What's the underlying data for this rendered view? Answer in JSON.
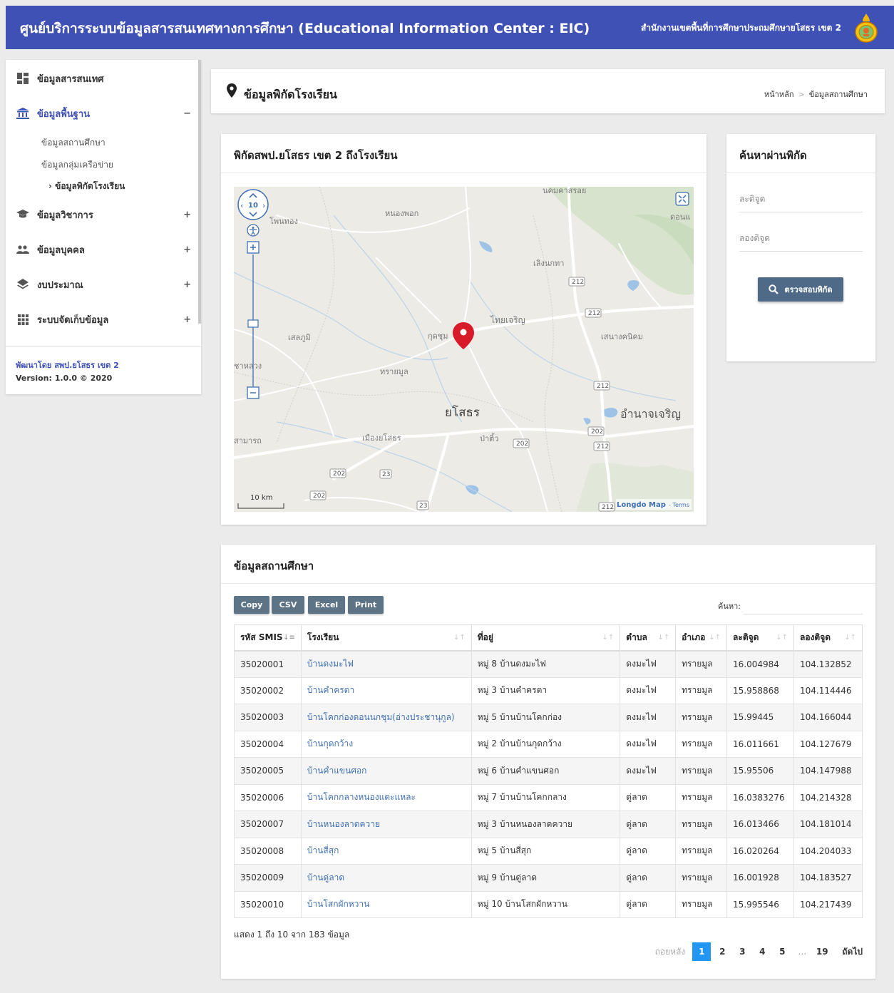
{
  "header": {
    "title": "ศูนย์บริการระบบข้อมูลสารสนเทศทางการศึกษา (Educational Information Center : EIC)",
    "office": "สำนักงานเขตพื้นที่การศึกษาประถมศึกษายโสธร เขต 2",
    "logo_icon": "school-emblem-icon"
  },
  "sidebar": {
    "items": [
      {
        "label": "ข้อมูลสารสนเทศ",
        "icon": "dashboard-icon",
        "toggle": ""
      },
      {
        "label": "ข้อมูลพื้นฐาน",
        "icon": "institution-icon",
        "toggle": "−"
      },
      {
        "label": "ข้อมูลวิชาการ",
        "icon": "graduation-cap-icon",
        "toggle": "+"
      },
      {
        "label": "ข้อมูลบุคคล",
        "icon": "people-icon",
        "toggle": "+"
      },
      {
        "label": "งบประมาณ",
        "icon": "layers-icon",
        "toggle": "+"
      },
      {
        "label": "ระบบจัดเก็บข้อมูล",
        "icon": "grid-icon",
        "toggle": "+"
      }
    ],
    "subitems": [
      "ข้อมูลสถานศึกษา",
      "ข้อมูลกลุ่มเครือข่าย",
      "ข้อมูลพิกัดโรงเรียน"
    ],
    "footer_dev": "พัฒนาโดย สพป.ยโสธร เขต 2",
    "footer_version": "Version: 1.0.0 © 2020"
  },
  "page": {
    "title": "ข้อมูลพิกัดโรงเรียน",
    "breadcrumb": [
      "หน้าหลัก",
      ">",
      "ข้อมูลสถานศึกษา"
    ]
  },
  "map": {
    "title": "พิกัดสพป.ยโสธร เขต 2 ถึงโรงเรียน",
    "zoom": "10",
    "scale": "10 km",
    "attribution": "Longdo Map",
    "terms": "- Terms",
    "labels": [
      "นคมคาสรอย",
      "โพนทอง",
      "หนองพอก",
      "ดอนแ",
      "เลิงนกทา",
      "212",
      "212",
      "ไทยเจริญ",
      "เสลภูมิ",
      "กุดชุม",
      "เสนางคนิคม",
      "ชาหลวง",
      "ทรายมูล",
      "212",
      "ยโสธร",
      "อำนาจเจริญ",
      "สามารถ",
      "เมืองยโสธร",
      "ป่าติ้ว",
      "202",
      "202",
      "212",
      "202",
      "23",
      "202",
      "23",
      "212"
    ],
    "colors": {
      "marker": "#d81b2a",
      "road": "#ffffff",
      "water": "#9fc3e7",
      "terrain": "#ecebe6"
    }
  },
  "search": {
    "title": "ค้นหาผ่านพิกัด",
    "lat_placeholder": "ละติจูด",
    "lng_placeholder": "ลองติจูด",
    "button_label": "ตรวจสอบพิกัด"
  },
  "table": {
    "title": "ข้อมูลสถานศึกษา",
    "buttons": [
      "Copy",
      "CSV",
      "Excel",
      "Print"
    ],
    "search_label": "ค้นหา:",
    "columns": [
      "รหัส SMIS",
      "โรงเรียน",
      "ที่อยู่",
      "ตำบล",
      "อำเภอ",
      "ละติจูด",
      "ลองติจูด"
    ],
    "sort_icons": [
      "↓≡",
      "↓↑",
      "↓↑",
      "↓↑",
      "↓↑",
      "↓↑",
      "↓↑"
    ],
    "rows": [
      [
        "35020001",
        "บ้านดงมะไฟ",
        "หมู่ 8 บ้านดงมะไฟ",
        "ดงมะไฟ",
        "ทรายมูล",
        "16.004984",
        "104.132852"
      ],
      [
        "35020002",
        "บ้านคำครตา",
        "หมู่ 3 บ้านคำครตา",
        "ดงมะไฟ",
        "ทรายมูล",
        "15.958868",
        "104.114446"
      ],
      [
        "35020003",
        "บ้านโคกก่องดอนนกชุม(อ่างประชานุกูล)",
        "หมู่ 5 บ้านบ้านโคกก่อง",
        "ดงมะไฟ",
        "ทรายมูล",
        "15.99445",
        "104.166044"
      ],
      [
        "35020004",
        "บ้านกุดกว้าง",
        "หมู่ 2 บ้านบ้านกุดกว้าง",
        "ดงมะไฟ",
        "ทรายมูล",
        "16.011661",
        "104.127679"
      ],
      [
        "35020005",
        "บ้านคำแขนศอก",
        "หมู่ 6 บ้านคำแขนศอก",
        "ดงมะไฟ",
        "ทรายมูล",
        "15.95506",
        "104.147988"
      ],
      [
        "35020006",
        "บ้านโคกกลางหนองแตะแหละ",
        "หมู่ 7 บ้านบ้านโคกกลาง",
        "ดู่ลาด",
        "ทรายมูล",
        "16.0383276",
        "104.214328"
      ],
      [
        "35020007",
        "บ้านหนองลาดควาย",
        "หมู่ 3 บ้านหนองลาดควาย",
        "ดู่ลาด",
        "ทรายมูล",
        "16.013466",
        "104.181014"
      ],
      [
        "35020008",
        "บ้านสี่สุก",
        "หมู่ 5 บ้านสี่สุก",
        "ดู่ลาด",
        "ทรายมูล",
        "16.020264",
        "104.204033"
      ],
      [
        "35020009",
        "บ้านดู่ลาด",
        "หมู่ 9 บ้านดู่ลาด",
        "ดู่ลาด",
        "ทรายมูล",
        "16.001928",
        "104.183527"
      ],
      [
        "35020010",
        "บ้านโสกผักหวาน",
        "หมู่ 10 บ้านโสกผักหวาน",
        "ดู่ลาด",
        "ทรายมูล",
        "15.995546",
        "104.217439"
      ]
    ],
    "info": "แสดง 1 ถึง 10 จาก 183 ข้อมูล",
    "pagination": {
      "prev": "ถอยหลัง",
      "pages": [
        "1",
        "2",
        "3",
        "4",
        "5",
        "…",
        "19"
      ],
      "next": "ถัดไป",
      "current": "1"
    }
  }
}
